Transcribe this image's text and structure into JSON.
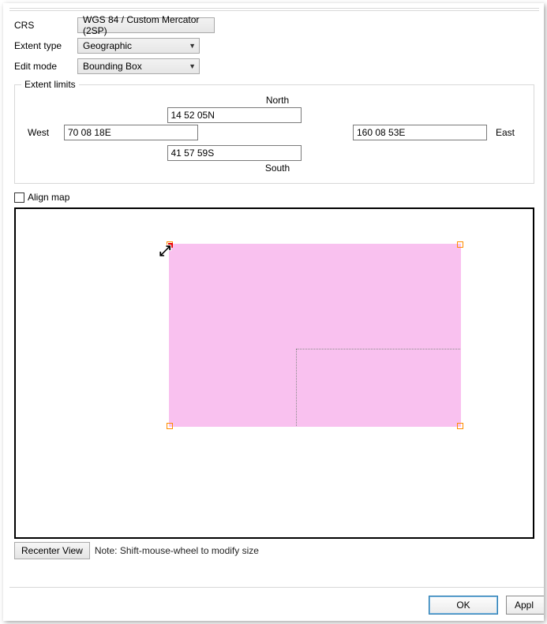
{
  "form": {
    "crs_label": "CRS",
    "crs_value": "WGS 84 / Custom Mercator (2SP)",
    "extent_type_label": "Extent type",
    "extent_type_value": "Geographic",
    "edit_mode_label": "Edit mode",
    "edit_mode_value": "Bounding Box"
  },
  "extent": {
    "legend": "Extent limits",
    "north_label": "North",
    "south_label": "South",
    "west_label": "West",
    "east_label": "East",
    "north_value": "14 52 05N",
    "south_value": "41 57 59S",
    "west_value": "70 08 18E",
    "east_value": "160 08 53E"
  },
  "align": {
    "checked": false,
    "label": "Align map"
  },
  "below": {
    "recenter_label": "Recenter View",
    "note": "Note: Shift-mouse-wheel to modify size"
  },
  "footer": {
    "ok": "OK",
    "apply": "Appl"
  }
}
